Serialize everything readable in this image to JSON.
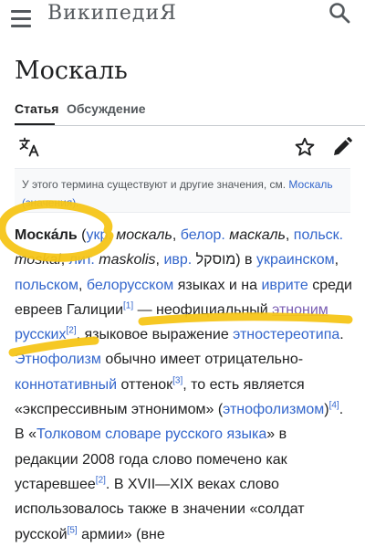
{
  "header": {
    "logo": "ВикипедиЯ",
    "menu_icon": "hamburger-menu-icon",
    "search_icon": "search-icon"
  },
  "page": {
    "title": "Москаль"
  },
  "tabs": [
    {
      "label": "Статья",
      "active": true
    },
    {
      "label": "Обсуждение",
      "active": false
    }
  ],
  "tools": {
    "translate_icon": "language-icon",
    "watch_icon": "star-icon",
    "edit_icon": "pencil-icon"
  },
  "hatnote": {
    "text": "У этого термина существуют и другие значения, см.",
    "link": "Москаль (значения)",
    "tail": "."
  },
  "article": {
    "term": "Моска́ль",
    "p1": " (",
    "ukr_abbr": "укр.",
    "ukr_word": " москаль",
    "c1": ", ",
    "bel_abbr": "белор.",
    "bel_word": " маскаль",
    "c2": ", ",
    "pol_abbr": "польск.",
    "pol_word": "moskal",
    "c3": ", ",
    "lit_abbr": "лит.",
    "lit_word": " maskolis",
    "c4": ", ",
    "heb_abbr": "ивр.",
    "heb_word": " מוסקל",
    "p2": ") в ",
    "ukrainian": "украинском",
    "c5": ", ",
    "polish": "польском",
    "c6": ", ",
    "belarusian": "белорусском",
    "t1": " языках и на ",
    "hebrew": "иврите",
    "t2": " среди евреев Галиции",
    "ref1": "[1]",
    "t3": " — неофициальный ",
    "ethnonym": "этноним",
    "t3b": " ",
    "russians": "русских",
    "ref2": "[2]",
    "t4": ", языковое выражение ",
    "stereotype": "этностереотипа",
    "t5": ". ",
    "ethnophaulism": "Этнофолизм",
    "t6": " обычно имеет отрицательно-",
    "connotative": "коннотативный",
    "t7": " оттенок",
    "ref3": "[3]",
    "t8": ", то есть является «экспрессивным этнонимом» (",
    "ethnophaulism2": "этнофолизмом",
    "t9": ")",
    "ref4": "[4]",
    "t10": ". В «",
    "dictionary": "Толковом словаре русского языка",
    "t11": "» в редакции 2008 года слово помечено как устаревшее",
    "ref5": "[2]",
    "t12": ". В XVII—XIX веках слово использовалось также в значении «солдат русской",
    "ref6": "[5]",
    "t13": " армии» (вне"
  },
  "colors": {
    "link": "#3366cc",
    "visited": "#795cb2",
    "highlighter": "#f5c518"
  }
}
